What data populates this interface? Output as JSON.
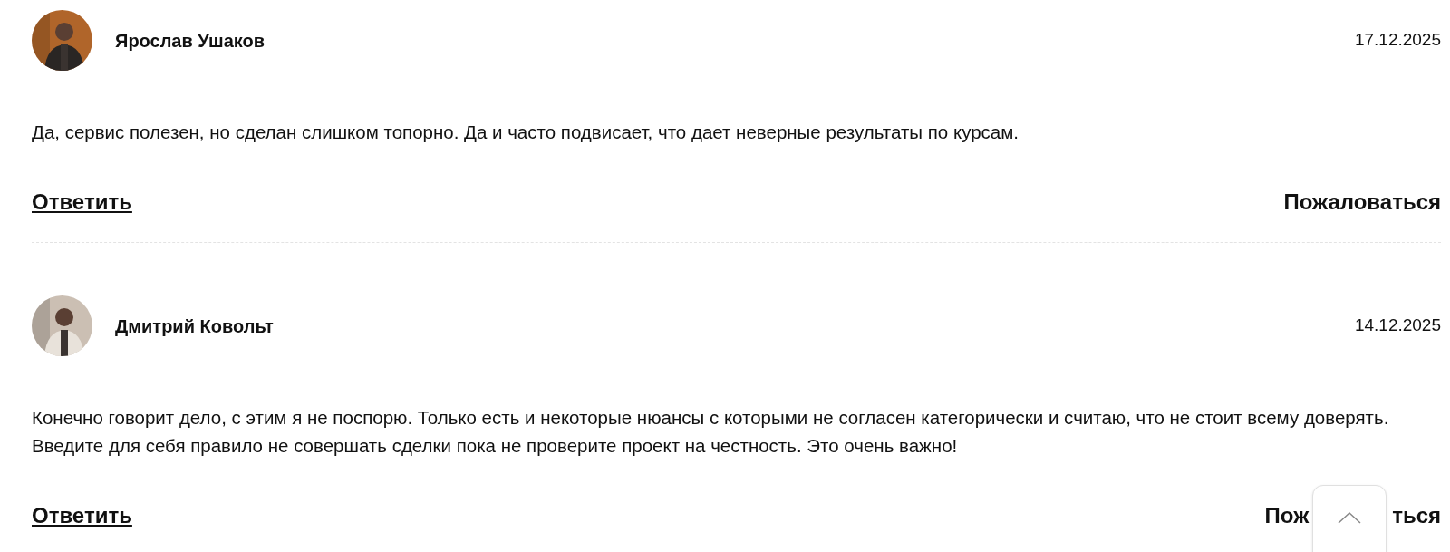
{
  "comments": [
    {
      "author": "Ярослав Ушаков",
      "date": "17.12.2025",
      "text": "Да, сервис полезен, но сделан слишком топорно. Да и часто подвисает, что дает неверные результаты по курсам.",
      "reply": "Ответить",
      "report": [
        "Пожаловаться"
      ],
      "avatar": {
        "kind": "picture"
      }
    },
    {
      "author": "Дмитрий Ковольт",
      "date": "14.12.2025",
      "text": "Конечно говорит дело, с этим я не поспорю. Только есть и некоторые нюансы с которыми не согласен категорически и считаю, что не стоит всему доверять. Введите для себя правило не совершать сделки пока не проверите проект на честность. Это очень важно!",
      "reply": "Ответить",
      "report": [
        "Пож",
        "ться"
      ],
      "avatar": {
        "kind": "picture"
      }
    }
  ]
}
